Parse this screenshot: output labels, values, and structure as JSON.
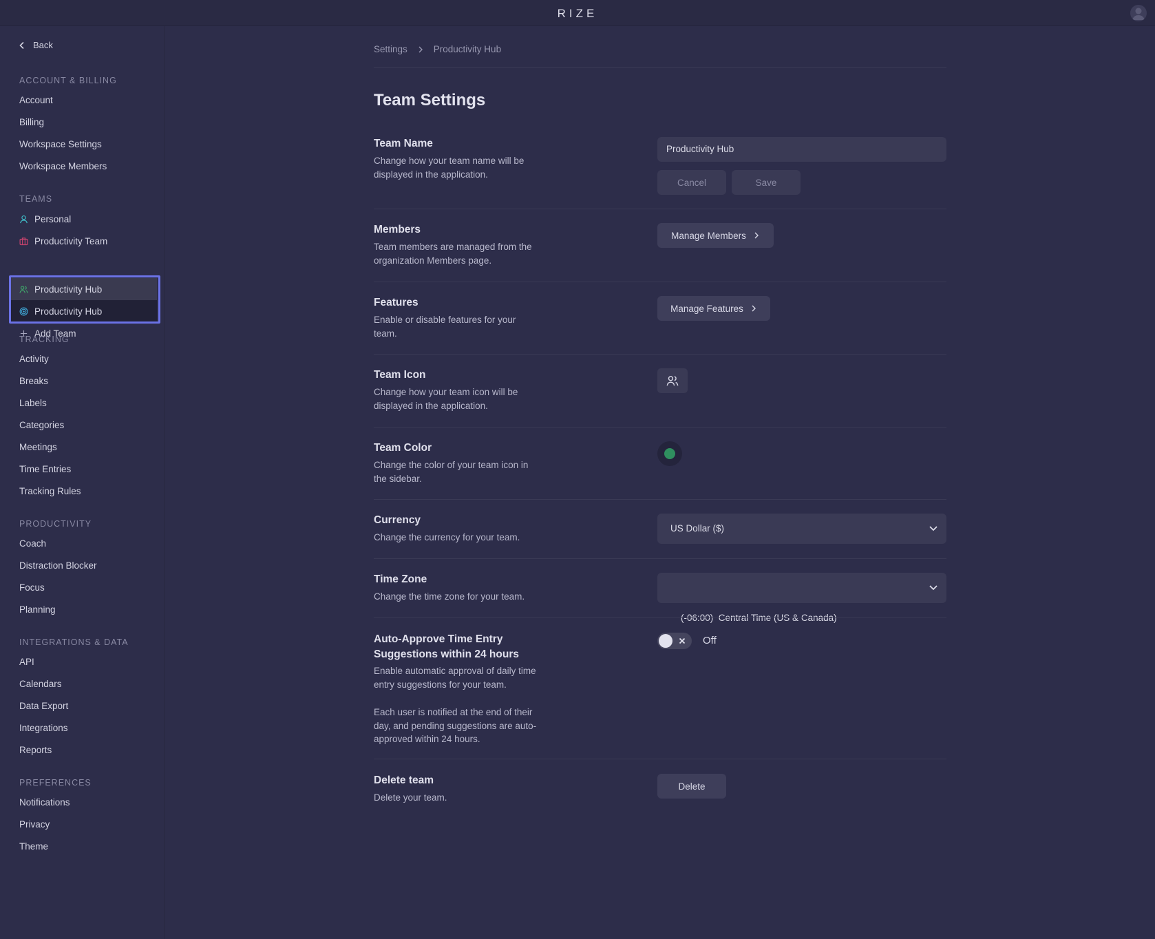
{
  "app": {
    "title": "RIZE"
  },
  "sidebar": {
    "back_label": "Back",
    "account_section": "ACCOUNT & BILLING",
    "account_items": [
      "Account",
      "Billing",
      "Workspace Settings",
      "Workspace Members"
    ],
    "teams_section": "TEAMS",
    "teams": [
      {
        "label": "Personal",
        "icon": "person-icon",
        "color": "#3fb8c4"
      },
      {
        "label": "Productivity Team",
        "icon": "briefcase-icon",
        "color": "#c8436e"
      },
      {
        "label": "Productivity Hub",
        "icon": "users-icon",
        "color": "#3faa6b"
      },
      {
        "label": "Productivity Hub",
        "icon": "target-icon",
        "color": "#3fa7d6"
      }
    ],
    "add_team_label": "Add Team",
    "tracking_section": "TRACKING",
    "tracking_items": [
      "Activity",
      "Breaks",
      "Labels",
      "Categories",
      "Meetings",
      "Time Entries",
      "Tracking Rules"
    ],
    "productivity_section": "PRODUCTIVITY",
    "productivity_items": [
      "Coach",
      "Distraction Blocker",
      "Focus",
      "Planning"
    ],
    "integrations_section": "INTEGRATIONS & DATA",
    "integrations_items": [
      "API",
      "Calendars",
      "Data Export",
      "Integrations",
      "Reports"
    ],
    "preferences_section": "PREFERENCES",
    "preferences_items": [
      "Notifications",
      "Privacy",
      "Theme"
    ]
  },
  "breadcrumb": {
    "root": "Settings",
    "current": "Productivity Hub"
  },
  "page": {
    "title": "Team Settings"
  },
  "team_name": {
    "title": "Team Name",
    "desc": "Change how your team name will be displayed in the application.",
    "value": "Productivity Hub",
    "cancel_label": "Cancel",
    "save_label": "Save"
  },
  "members": {
    "title": "Members",
    "desc": "Team members are managed from the organization Members page.",
    "button_label": "Manage Members"
  },
  "features": {
    "title": "Features",
    "desc": "Enable or disable features for your team.",
    "button_label": "Manage Features"
  },
  "team_icon": {
    "title": "Team Icon",
    "desc": "Change how your team icon will be displayed in the application.",
    "icon": "users-icon"
  },
  "team_color": {
    "title": "Team Color",
    "desc": "Change the color of your team icon in the sidebar.",
    "color": "#2f8f5f"
  },
  "currency": {
    "title": "Currency",
    "desc": "Change the currency for your team.",
    "value": "US Dollar ($)"
  },
  "timezone": {
    "title": "Time Zone",
    "desc": "Change the time zone for your team.",
    "value": "(-06:00)  Central Time (US & Canada)"
  },
  "auto_approve": {
    "title": "Auto-Approve Time Entry Suggestions within 24 hours",
    "desc1": "Enable automatic approval of daily time entry suggestions for your team.",
    "desc2": "Each user is notified at the end of their day, and pending suggestions are auto-approved within 24 hours.",
    "state_label": "Off"
  },
  "delete_team": {
    "title": "Delete team",
    "desc": "Delete your team.",
    "button_label": "Delete"
  }
}
